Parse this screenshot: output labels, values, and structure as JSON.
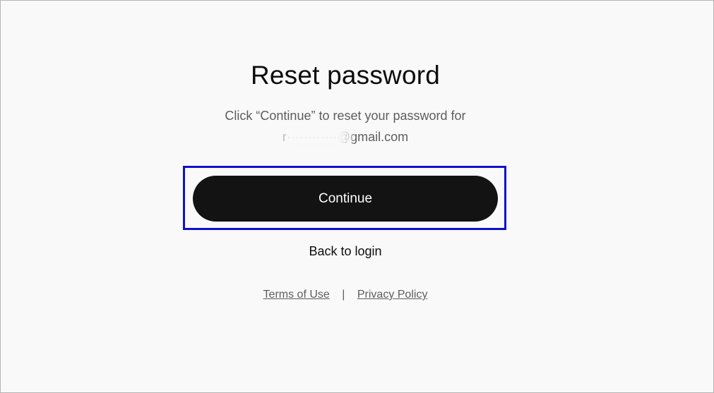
{
  "page": {
    "title": "Reset password",
    "subtitle": "Click “Continue” to reset your password for",
    "email": "r············@gmail.com"
  },
  "actions": {
    "continue_label": "Continue",
    "back_label": "Back to login"
  },
  "footer": {
    "terms_label": "Terms of Use",
    "separator": "|",
    "privacy_label": "Privacy Policy"
  },
  "colors": {
    "background": "#f9f9f9",
    "button": "#131313",
    "highlight_border": "#1010c8",
    "secondary_text": "#5d5d5d"
  }
}
